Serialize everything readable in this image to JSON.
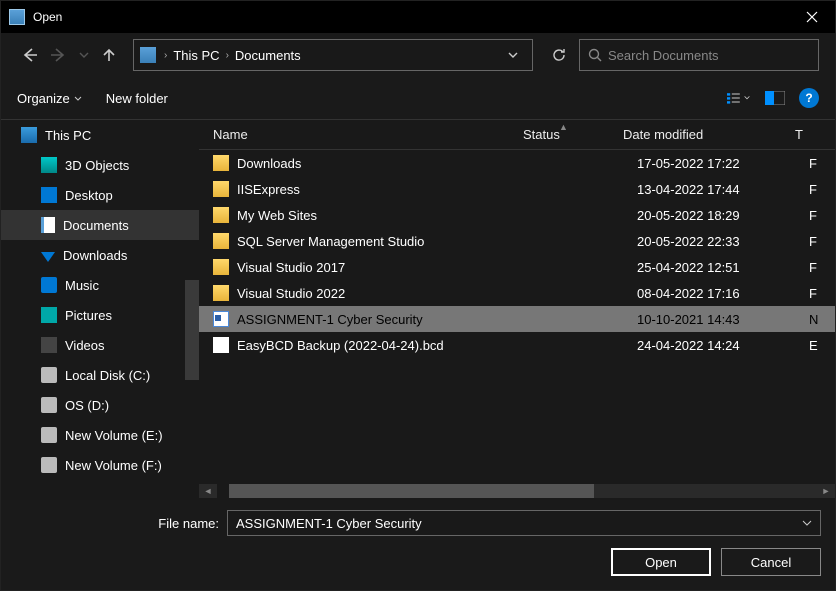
{
  "window_title": "Open",
  "breadcrumb": {
    "items": [
      "This PC",
      "Documents"
    ]
  },
  "search": {
    "placeholder": "Search Documents"
  },
  "toolbar": {
    "organize": "Organize",
    "new_folder": "New folder"
  },
  "columns": {
    "name": "Name",
    "status": "Status",
    "date": "Date modified",
    "type": "T"
  },
  "sidebar": {
    "root": "This PC",
    "items": [
      {
        "label": "3D Objects",
        "icon": "3d"
      },
      {
        "label": "Desktop",
        "icon": "desktop"
      },
      {
        "label": "Documents",
        "icon": "docs",
        "selected": true
      },
      {
        "label": "Downloads",
        "icon": "down"
      },
      {
        "label": "Music",
        "icon": "music"
      },
      {
        "label": "Pictures",
        "icon": "pics"
      },
      {
        "label": "Videos",
        "icon": "videos"
      },
      {
        "label": "Local Disk (C:)",
        "icon": "disk"
      },
      {
        "label": "OS (D:)",
        "icon": "disk"
      },
      {
        "label": "New Volume (E:)",
        "icon": "disk"
      },
      {
        "label": "New Volume (F:)",
        "icon": "disk"
      }
    ]
  },
  "files": [
    {
      "name": "Downloads",
      "date": "17-05-2022 17:22",
      "type": "F",
      "icon": "folder"
    },
    {
      "name": "IISExpress",
      "date": "13-04-2022 17:44",
      "type": "F",
      "icon": "folder"
    },
    {
      "name": "My Web Sites",
      "date": "20-05-2022 18:29",
      "type": "F",
      "icon": "folder"
    },
    {
      "name": "SQL Server Management Studio",
      "date": "20-05-2022 22:33",
      "type": "F",
      "icon": "folder"
    },
    {
      "name": "Visual Studio 2017",
      "date": "25-04-2022 12:51",
      "type": "F",
      "icon": "folder"
    },
    {
      "name": "Visual Studio 2022",
      "date": "08-04-2022 17:16",
      "type": "F",
      "icon": "folder"
    },
    {
      "name": "ASSIGNMENT-1 Cyber Security",
      "date": "10-10-2021 14:43",
      "type": "N",
      "icon": "word",
      "selected": true
    },
    {
      "name": "EasyBCD Backup (2022-04-24).bcd",
      "date": "24-04-2022 14:24",
      "type": "E",
      "icon": "file"
    }
  ],
  "footer": {
    "filename_label": "File name:",
    "filename_value": "ASSIGNMENT-1 Cyber Security",
    "open": "Open",
    "cancel": "Cancel"
  }
}
